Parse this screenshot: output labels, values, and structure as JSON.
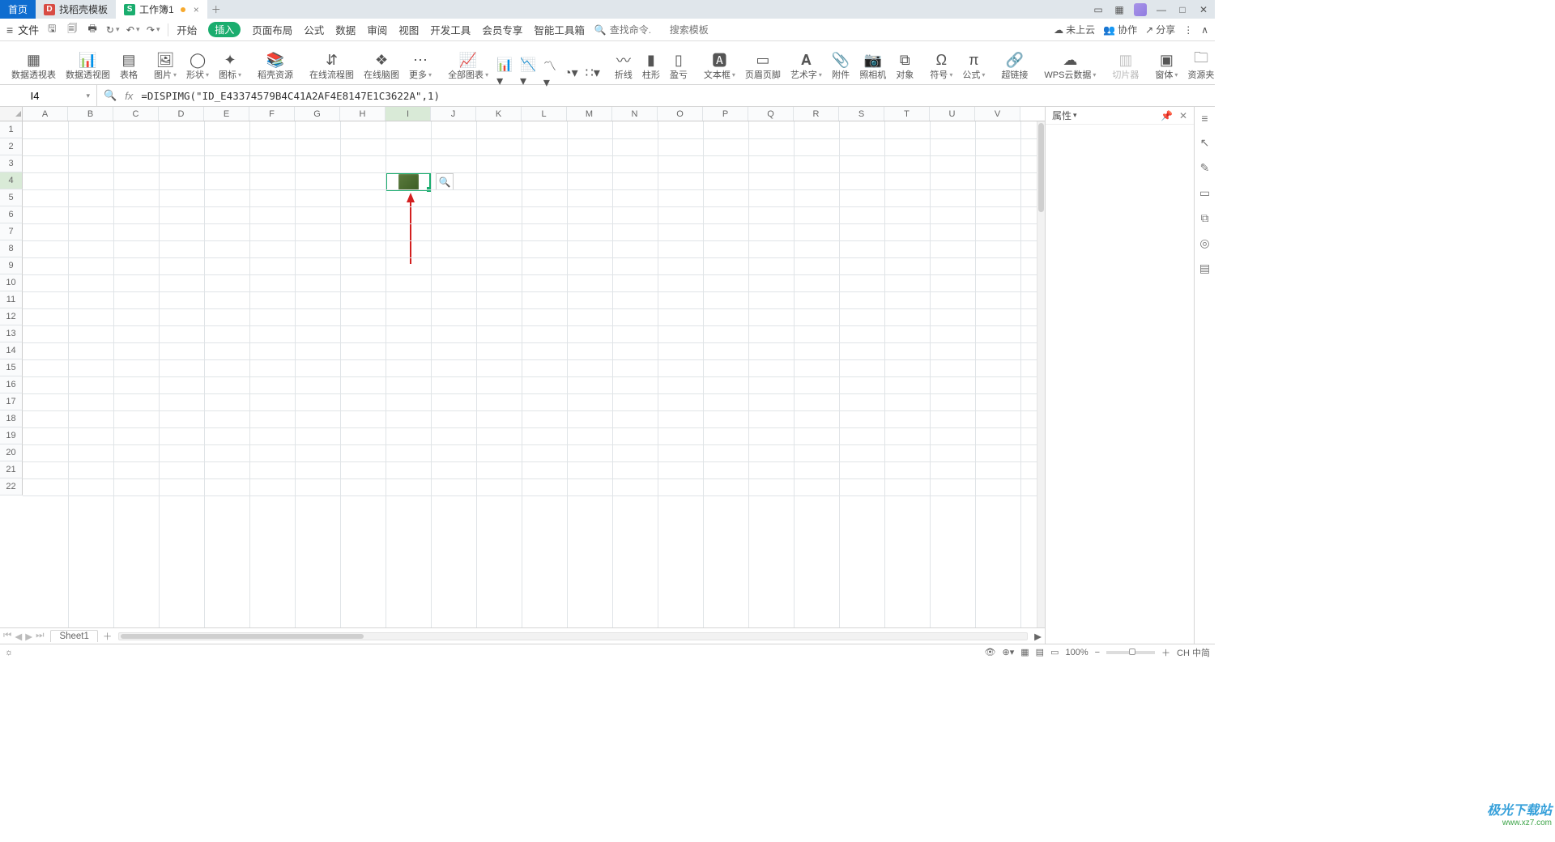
{
  "tabs": {
    "home": "首页",
    "template": "找稻壳模板",
    "doc": "工作簿1"
  },
  "file_menu": "文件",
  "menus": [
    "开始",
    "插入",
    "页面布局",
    "公式",
    "数据",
    "审阅",
    "视图",
    "开发工具",
    "会员专享",
    "智能工具箱"
  ],
  "menu_active": "插入",
  "search": {
    "placeholder_cmd": "查找命令.",
    "placeholder_tpl": "搜索模板"
  },
  "top_right": {
    "cloud": "未上云",
    "collab": "协作",
    "share": "分享"
  },
  "ribbon": {
    "g1": [
      "数据透视表",
      "数据透视图",
      "表格"
    ],
    "g2": [
      "图片",
      "形状",
      "图标"
    ],
    "g3": [
      "稻壳资源"
    ],
    "g4": [
      "在线流程图",
      "在线脑图",
      "更多"
    ],
    "g5": [
      "全部图表"
    ],
    "g6": [
      "折线",
      "柱形",
      "盈亏"
    ],
    "g7": [
      "文本框",
      "页眉页脚",
      "艺术字",
      "附件",
      "照相机",
      "对象"
    ],
    "g8": [
      "符号",
      "公式"
    ],
    "g9": [
      "超链接"
    ],
    "g10": [
      "WPS云数据"
    ],
    "g11": [
      "切片器"
    ],
    "g12": [
      "窗体",
      "资源夹"
    ]
  },
  "namebox": "I4",
  "formula": "=DISPIMG(\"ID_E43374579B4C41A2AF4E8147E1C3622A\",1)",
  "prop_title": "属性",
  "columns": [
    "A",
    "B",
    "C",
    "D",
    "E",
    "F",
    "G",
    "H",
    "I",
    "J",
    "K",
    "L",
    "M",
    "N",
    "O",
    "P",
    "Q",
    "R",
    "S",
    "T",
    "U",
    "V"
  ],
  "rows": [
    "1",
    "2",
    "3",
    "4",
    "5",
    "6",
    "7",
    "8",
    "9",
    "10",
    "11",
    "12",
    "13",
    "14",
    "15",
    "16",
    "17",
    "18",
    "19",
    "20",
    "21",
    "22"
  ],
  "active_col": "I",
  "active_row": "4",
  "sheet": "Sheet1",
  "zoom": "100%",
  "ime": "CH 中简",
  "watermark": {
    "a": "极光下载站",
    "b": "www.xz7.com"
  }
}
